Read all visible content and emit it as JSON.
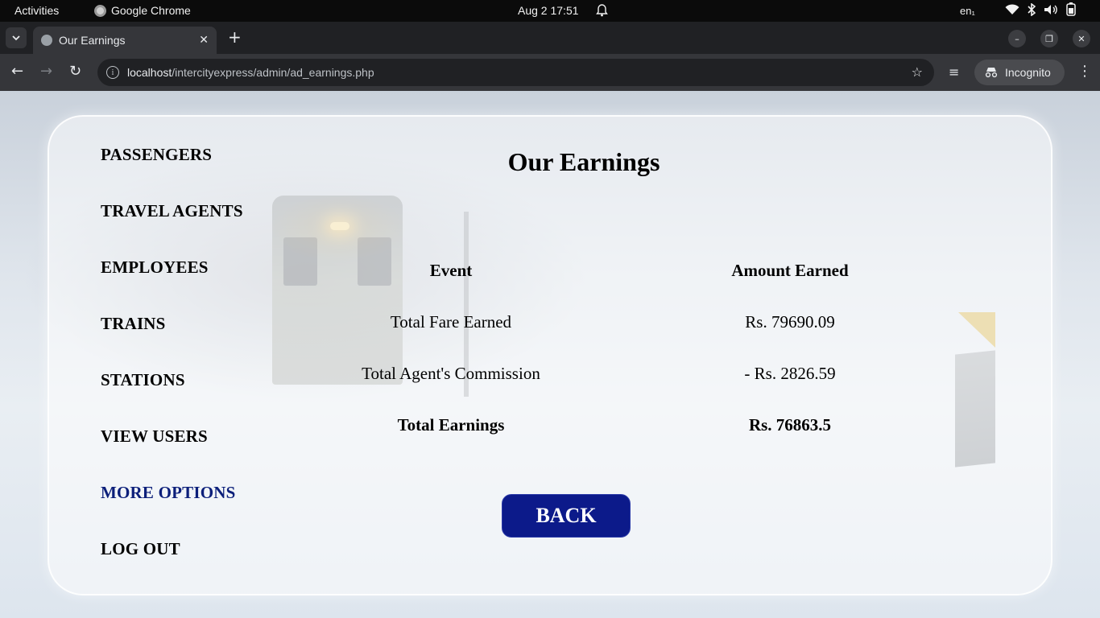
{
  "system_bar": {
    "activities": "Activities",
    "app_name": "Google Chrome",
    "datetime": "Aug 2  17:51",
    "language": "en₁"
  },
  "browser": {
    "tab_title": "Our Earnings",
    "url_host": "localhost",
    "url_path": "/intercityexpress/admin/ad_earnings.php",
    "profile_label": "Incognito"
  },
  "sidebar": {
    "items": [
      {
        "label": "PASSENGERS",
        "active": false
      },
      {
        "label": "TRAVEL AGENTS",
        "active": false
      },
      {
        "label": "EMPLOYEES",
        "active": false
      },
      {
        "label": "TRAINS",
        "active": false
      },
      {
        "label": "STATIONS",
        "active": false
      },
      {
        "label": "VIEW USERS",
        "active": false
      },
      {
        "label": "MORE OPTIONS",
        "active": true
      },
      {
        "label": "LOG OUT",
        "active": false
      }
    ]
  },
  "main": {
    "title": "Our Earnings",
    "table": {
      "headers": [
        "Event",
        "Amount Earned"
      ],
      "rows": [
        [
          "Total Fare Earned",
          "Rs. 79690.09"
        ],
        [
          "Total Agent's Commission",
          "- Rs. 2826.59"
        ],
        [
          "Total Earnings",
          "Rs. 76863.5"
        ]
      ]
    },
    "back_label": "BACK"
  },
  "colors": {
    "accent": "#0c1a8a",
    "active_nav": "#0c1f7a"
  }
}
